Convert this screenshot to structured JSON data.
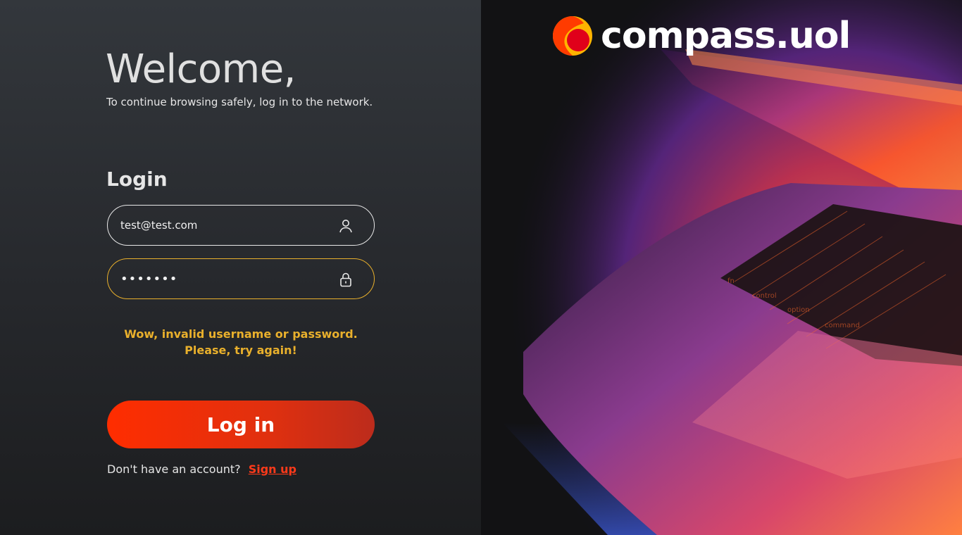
{
  "welcome": {
    "title": "Welcome,",
    "subtitle": "To continue browsing safely, log in to the network."
  },
  "login": {
    "heading": "Login",
    "username_value": "test@test.com",
    "password_value": "•••••••",
    "username_icon": "user-icon",
    "password_icon": "lock-icon",
    "error_line1": "Wow, invalid username or password.",
    "error_line2": "Please, try again!",
    "button_label": "Log in",
    "signup_prompt": "Don't have an account?",
    "signup_link": "Sign up"
  },
  "brand": {
    "name": "compass.uol"
  },
  "colors": {
    "accent_orange": "#ff2d00",
    "error_yellow": "#e9b02c",
    "link_red": "#ff3a1a"
  }
}
